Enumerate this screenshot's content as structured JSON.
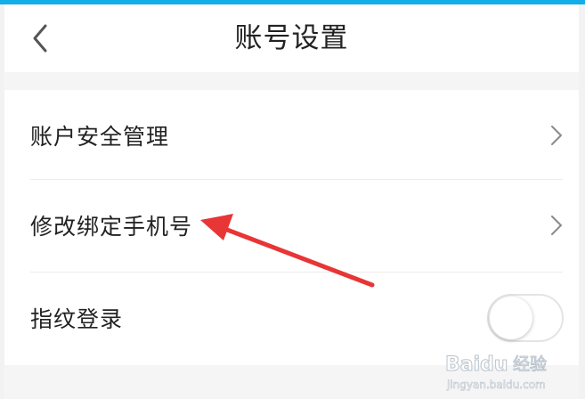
{
  "colors": {
    "accent": "#12aee8",
    "annotation_arrow": "#e83535"
  },
  "header": {
    "back_icon": "chevron-left-icon",
    "title": "账号设置"
  },
  "settings": {
    "items": [
      {
        "label": "账户安全管理",
        "control": "chevron-right-icon"
      },
      {
        "label": "修改绑定手机号",
        "control": "chevron-right-icon"
      },
      {
        "label": "指纹登录",
        "control": "toggle",
        "toggle_on": false
      }
    ]
  },
  "watermark": {
    "brand": "Baidu",
    "cn": "经验",
    "url": "jingyan.baidu.com"
  }
}
